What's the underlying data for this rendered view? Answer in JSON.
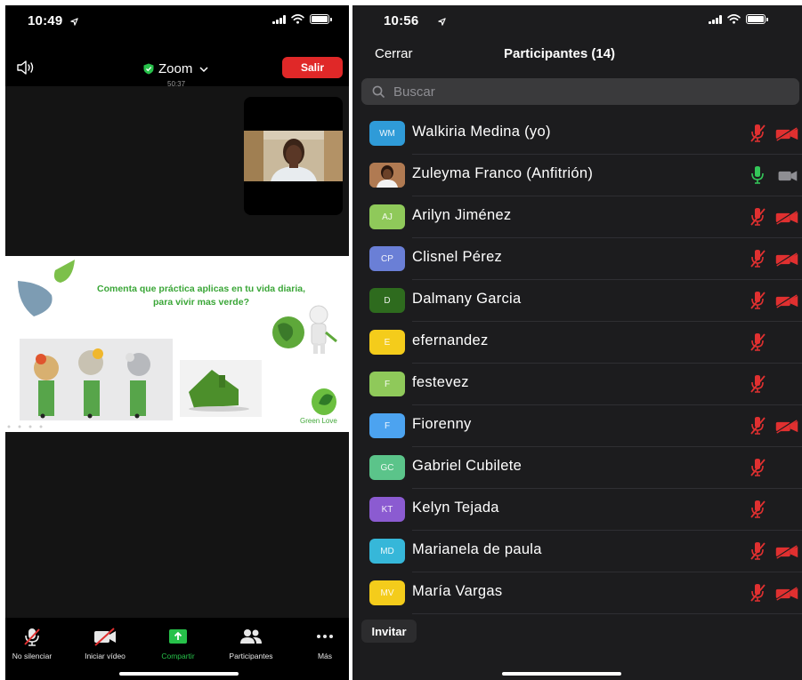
{
  "left_screen": {
    "status_time": "10:49",
    "meeting_title": "Zoom",
    "meeting_timer": "50:37",
    "leave_label": "Salir",
    "slide_text": "Comenta que práctica aplicas en tu vida diaria, para vivir mas verde?",
    "slide_brand": "Green Love",
    "toolbar": {
      "mute_label": "No silenciar",
      "video_label": "Iniciar vídeo",
      "share_label": "Compartir",
      "participants_label": "Participantes",
      "more_label": "Más"
    },
    "colors": {
      "leave": "#e02828",
      "share": "#27c14a",
      "brand": "#3aa637"
    }
  },
  "right_screen": {
    "status_time": "10:56",
    "close_label": "Cerrar",
    "title": "Participantes (14)",
    "search_placeholder": "Buscar",
    "invite_label": "Invitar",
    "participants": [
      {
        "initials": "WM",
        "name": "Walkiria Medina (yo)",
        "avatar_color": "#2f9bd8",
        "mic": "muted",
        "video": "off"
      },
      {
        "initials": "",
        "name": "Zuleyma Franco (Anfitrión)",
        "avatar_color": "#b07a52",
        "mic": "on",
        "video": "on-gray"
      },
      {
        "initials": "AJ",
        "name": "Arilyn Jiménez",
        "avatar_color": "#8fc95a",
        "mic": "muted",
        "video": "off"
      },
      {
        "initials": "CP",
        "name": "Clisnel Pérez",
        "avatar_color": "#6a7fd6",
        "mic": "muted",
        "video": "off"
      },
      {
        "initials": "D",
        "name": "Dalmany Garcia",
        "avatar_color": "#2e6b1e",
        "mic": "muted",
        "video": "off"
      },
      {
        "initials": "E",
        "name": "efernandez",
        "avatar_color": "#f4cc1b",
        "mic": "muted",
        "video": "none"
      },
      {
        "initials": "F",
        "name": "festevez",
        "avatar_color": "#8fc95a",
        "mic": "muted",
        "video": "none"
      },
      {
        "initials": "F",
        "name": "Fiorenny",
        "avatar_color": "#4ca3f0",
        "mic": "muted",
        "video": "off"
      },
      {
        "initials": "GC",
        "name": "Gabriel Cubilete",
        "avatar_color": "#5bc48a",
        "mic": "muted",
        "video": "none"
      },
      {
        "initials": "KT",
        "name": "Kelyn Tejada",
        "avatar_color": "#8b5bd1",
        "mic": "muted",
        "video": "none"
      },
      {
        "initials": "MD",
        "name": "Marianela de paula",
        "avatar_color": "#36b7d9",
        "mic": "muted",
        "video": "off"
      },
      {
        "initials": "MV",
        "name": "María Vargas",
        "avatar_color": "#f4cc1b",
        "mic": "muted",
        "video": "off"
      }
    ],
    "colors": {
      "muted_red": "#e03030",
      "mic_green": "#34c759"
    }
  }
}
